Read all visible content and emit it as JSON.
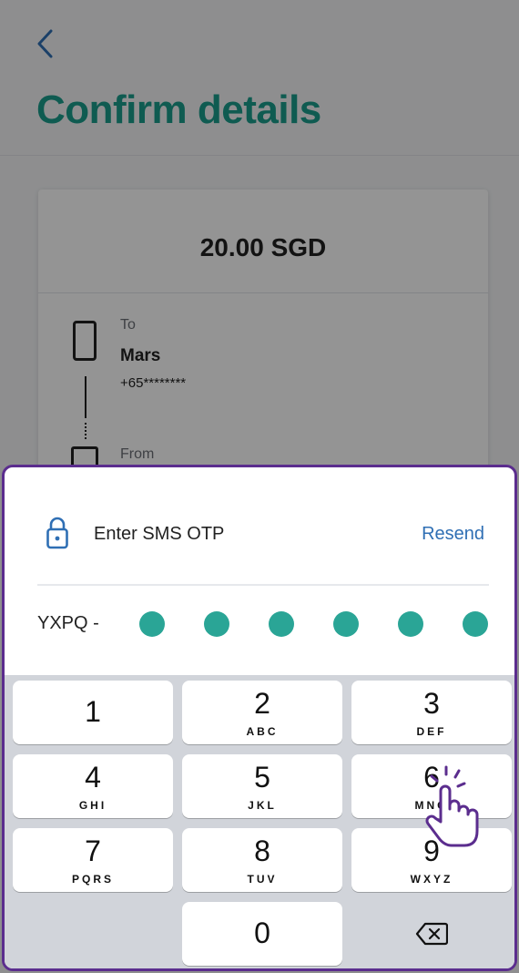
{
  "page": {
    "title": "Confirm details",
    "amount": "20.00 SGD",
    "to_label": "To",
    "to_name": "Mars",
    "to_phone": "+65********",
    "from_label": "From"
  },
  "otp": {
    "label": "Enter SMS OTP",
    "resend_label": "Resend",
    "prefix": "YXPQ -",
    "digits_entered": 6
  },
  "keypad": {
    "keys": [
      {
        "num": "1",
        "letters": ""
      },
      {
        "num": "2",
        "letters": "ABC"
      },
      {
        "num": "3",
        "letters": "DEF"
      },
      {
        "num": "4",
        "letters": "GHI"
      },
      {
        "num": "5",
        "letters": "JKL"
      },
      {
        "num": "6",
        "letters": "MNO"
      },
      {
        "num": "7",
        "letters": "PQRS"
      },
      {
        "num": "8",
        "letters": "TUV"
      },
      {
        "num": "9",
        "letters": "WXYZ"
      },
      {
        "num": "0",
        "letters": ""
      }
    ],
    "delete_icon": "backspace-icon"
  },
  "colors": {
    "accent": "#1a9e8c",
    "dot": "#2aa596",
    "link": "#2f6fb4",
    "sheet_border": "#5b2d8e"
  }
}
